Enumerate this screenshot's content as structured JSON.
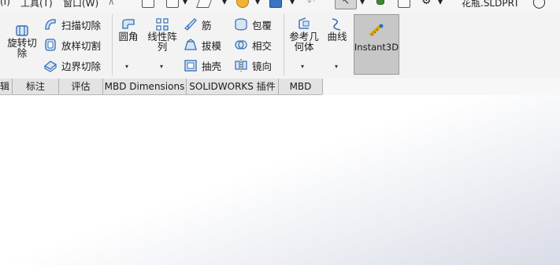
{
  "menubar": {
    "tools_label": "工具(T)",
    "window_label": "窗口(W)",
    "close_glyph": "×",
    "file_name": "花瓶.SLDPRT",
    "edge_text": "(I)"
  },
  "ribbon": {
    "revolve_cut": "旋转切除",
    "sweep_cut": "扫描切除",
    "loft_cut": "放样切割",
    "boundary_cut": "边界切除",
    "fillet": "圆角",
    "linear_pattern": "线性阵列",
    "rib": "筋",
    "draft": "拔模",
    "shell": "抽壳",
    "wrap": "包覆",
    "intersect": "相交",
    "mirror": "镜向",
    "ref_geometry": "参考几何体",
    "curves": "曲线",
    "instant3d": "Instant3D",
    "dropdown_glyph": "▾"
  },
  "tabs": {
    "t0": "辑",
    "t1": "标注",
    "t2": "评估",
    "t3": "MBD Dimensions",
    "t4": "SOLIDWORKS 插件",
    "t5": "MBD"
  },
  "colors": {
    "ribbon_bg": "#f3f3f3",
    "instant3d_active": "#c7c7c7",
    "icon_blue": "#2f6fb8"
  }
}
